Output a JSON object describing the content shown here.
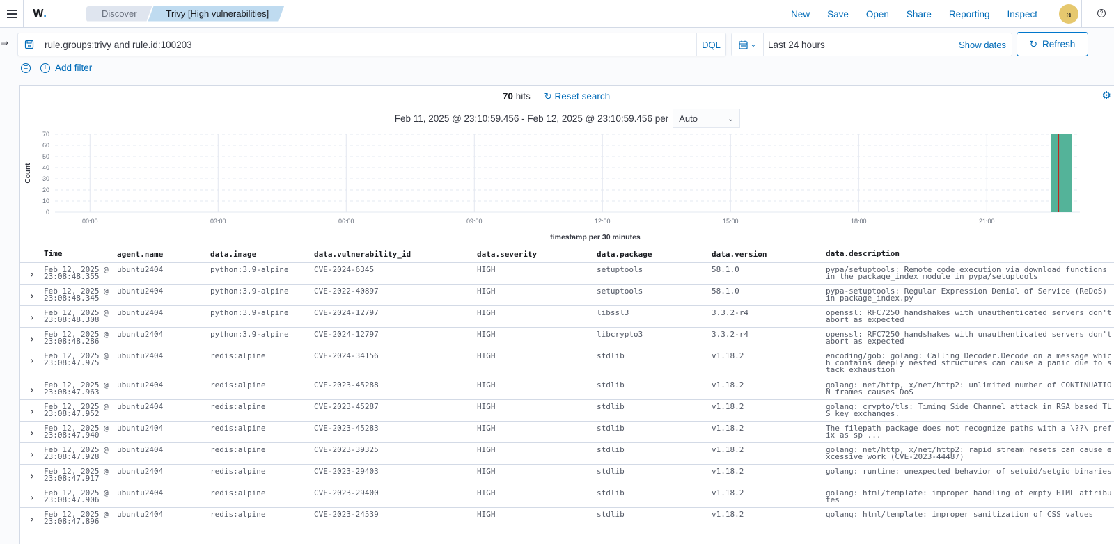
{
  "header": {
    "logo": "W",
    "breadcrumbs": [
      "Discover",
      "Trivy [High vulnerabilities]"
    ],
    "nav": [
      "New",
      "Save",
      "Open",
      "Share",
      "Reporting",
      "Inspect"
    ],
    "avatar": "a",
    "help_icon": "question-circle-icon"
  },
  "query": {
    "text": "rule.groups:trivy and rule.id:100203",
    "language": "DQL",
    "time_range": "Last 24 hours",
    "show_dates": "Show dates",
    "refresh": "Refresh",
    "add_filter": "Add filter"
  },
  "summary": {
    "hits_count": "70",
    "hits_label": "hits",
    "reset_search": "Reset search",
    "range_text": "Feb 11, 2025 @ 23:10:59.456 - Feb 12, 2025 @ 23:10:59.456 per",
    "interval": "Auto"
  },
  "chart_data": {
    "type": "bar",
    "title": "",
    "xlabel": "timestamp per 30 minutes",
    "ylabel": "Count",
    "ylim": [
      0,
      70
    ],
    "yticks": [
      0,
      10,
      20,
      30,
      40,
      50,
      60,
      70
    ],
    "xticks": [
      "00:00",
      "03:00",
      "06:00",
      "09:00",
      "12:00",
      "15:00",
      "18:00",
      "21:00"
    ],
    "x_range_hours": [
      -0.82,
      23.18
    ],
    "bars": [
      {
        "start_hour": 22.5,
        "end_hour": 23.0,
        "value": 70
      }
    ],
    "now_marker_hour": 22.68,
    "bar_color": "#54b399",
    "marker_color": "#bd271e",
    "grid": true
  },
  "table": {
    "columns": [
      "Time",
      "agent.name",
      "data.image",
      "data.vulnerability_id",
      "data.severity",
      "data.package",
      "data.version",
      "data.description"
    ],
    "rows": [
      [
        "Feb 12, 2025 @\n23:08:48.355",
        "ubuntu2404",
        "python:3.9-alpine",
        "CVE-2024-6345",
        "HIGH",
        "setuptools",
        "58.1.0",
        "pypa/setuptools: Remote code execution via download functions in the package_index module in pypa/setuptools"
      ],
      [
        "Feb 12, 2025 @\n23:08:48.345",
        "ubuntu2404",
        "python:3.9-alpine",
        "CVE-2022-40897",
        "HIGH",
        "setuptools",
        "58.1.0",
        "pypa-setuptools: Regular Expression Denial of Service (ReDoS) in package_index.py"
      ],
      [
        "Feb 12, 2025 @\n23:08:48.308",
        "ubuntu2404",
        "python:3.9-alpine",
        "CVE-2024-12797",
        "HIGH",
        "libssl3",
        "3.3.2-r4",
        "openssl: RFC7250 handshakes with unauthenticated servers don't abort as expected"
      ],
      [
        "Feb 12, 2025 @\n23:08:48.286",
        "ubuntu2404",
        "python:3.9-alpine",
        "CVE-2024-12797",
        "HIGH",
        "libcrypto3",
        "3.3.2-r4",
        "openssl: RFC7250 handshakes with unauthenticated servers don't abort as expected"
      ],
      [
        "Feb 12, 2025 @\n23:08:47.975",
        "ubuntu2404",
        "redis:alpine",
        "CVE-2024-34156",
        "HIGH",
        "stdlib",
        "v1.18.2",
        "encoding/gob: golang: Calling Decoder.Decode on a message which contains deeply nested structures can cause a panic due to stack exhaustion"
      ],
      [
        "Feb 12, 2025 @\n23:08:47.963",
        "ubuntu2404",
        "redis:alpine",
        "CVE-2023-45288",
        "HIGH",
        "stdlib",
        "v1.18.2",
        "golang: net/http, x/net/http2: unlimited number of CONTINUATION frames causes DoS"
      ],
      [
        "Feb 12, 2025 @\n23:08:47.952",
        "ubuntu2404",
        "redis:alpine",
        "CVE-2023-45287",
        "HIGH",
        "stdlib",
        "v1.18.2",
        "golang: crypto/tls: Timing Side Channel attack in RSA based TLS key exchanges."
      ],
      [
        "Feb 12, 2025 @\n23:08:47.940",
        "ubuntu2404",
        "redis:alpine",
        "CVE-2023-45283",
        "HIGH",
        "stdlib",
        "v1.18.2",
        "The filepath package does not recognize paths with a \\??\\ prefix as sp ..."
      ],
      [
        "Feb 12, 2025 @\n23:08:47.928",
        "ubuntu2404",
        "redis:alpine",
        "CVE-2023-39325",
        "HIGH",
        "stdlib",
        "v1.18.2",
        "golang: net/http, x/net/http2: rapid stream resets can cause excessive work (CVE-2023-44487)"
      ],
      [
        "Feb 12, 2025 @\n23:08:47.917",
        "ubuntu2404",
        "redis:alpine",
        "CVE-2023-29403",
        "HIGH",
        "stdlib",
        "v1.18.2",
        "golang: runtime: unexpected behavior of setuid/setgid binaries"
      ],
      [
        "Feb 12, 2025 @\n23:08:47.906",
        "ubuntu2404",
        "redis:alpine",
        "CVE-2023-29400",
        "HIGH",
        "stdlib",
        "v1.18.2",
        "golang: html/template: improper handling of empty HTML attributes"
      ],
      [
        "Feb 12, 2025 @\n23:08:47.896",
        "ubuntu2404",
        "redis:alpine",
        "CVE-2023-24539",
        "HIGH",
        "stdlib",
        "v1.18.2",
        "golang: html/template: improper sanitization of CSS values"
      ]
    ]
  }
}
